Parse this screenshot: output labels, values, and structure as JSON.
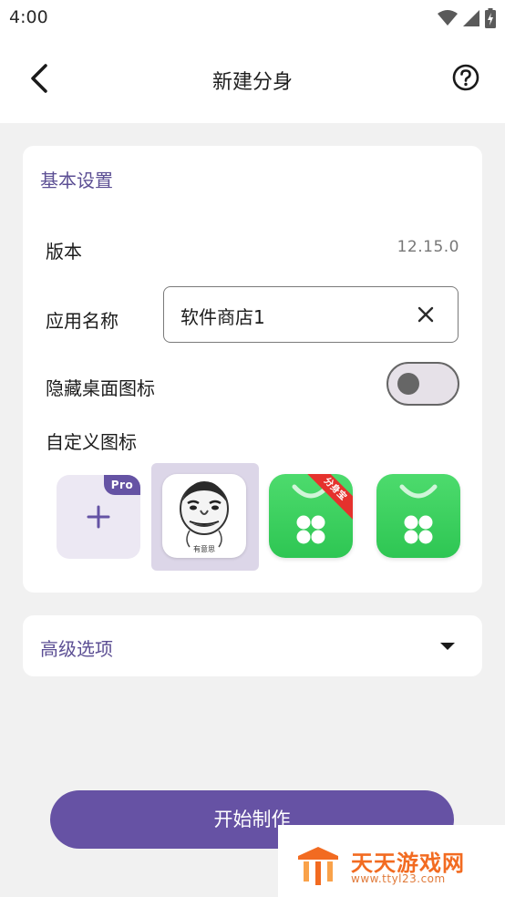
{
  "status_bar": {
    "time": "4:00",
    "icons": [
      "wifi-icon",
      "signal-icon",
      "battery-icon"
    ]
  },
  "app_bar": {
    "title": "新建分身",
    "back_icon": "chevron-left-icon",
    "help_icon": "help-circle-icon"
  },
  "basic_settings": {
    "section_title": "基本设置",
    "version_label": "版本",
    "version_value": "12.15.0",
    "app_name_label": "应用名称",
    "app_name_value": "软件商店1",
    "hide_icon_label": "隐藏桌面图标",
    "hide_icon_enabled": false,
    "custom_icon_label": "自定义图标",
    "icon_options": [
      {
        "name": "add-custom-icon",
        "pro_badge": "Pro"
      },
      {
        "name": "meme-face-icon",
        "caption": "有意思",
        "selected": true
      },
      {
        "name": "app-store-clone-icon",
        "ribbon": "分身宝"
      },
      {
        "name": "app-store-icon"
      }
    ]
  },
  "advanced": {
    "title": "高级选项",
    "icon": "dropdown-arrow-icon"
  },
  "start_button": {
    "label": "开始制作"
  },
  "watermark": {
    "name": "天天游戏网",
    "url": "www.ttyl23.com"
  },
  "colors": {
    "accent": "#6652a4",
    "section_title": "#5c4f94",
    "ribbon": "#e5322d",
    "store_green": "#3fd35f",
    "watermark_orange": "#f26b21"
  }
}
